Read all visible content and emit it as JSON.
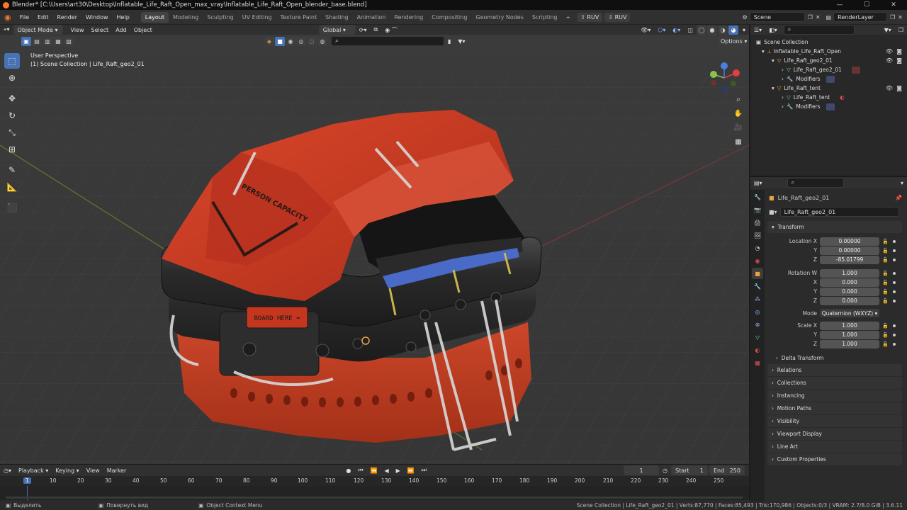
{
  "title_bar": {
    "text": "Blender* [C:\\Users\\art30\\Desktop\\Inflatable_Life_Raft_Open_max_vray\\Inflatable_Life_Raft_Open_blender_base.blend]",
    "min": "—",
    "max": "☐",
    "close": "✕"
  },
  "menu": [
    "File",
    "Edit",
    "Render",
    "Window",
    "Help"
  ],
  "workspaces": [
    "Layout",
    "Modeling",
    "Sculpting",
    "UV Editing",
    "Texture Paint",
    "Shading",
    "Animation",
    "Rendering",
    "Compositing",
    "Geometry Nodes",
    "Scripting"
  ],
  "addons": {
    "btn1": "RUV",
    "btn2": "RUV"
  },
  "scene": "Scene",
  "render_layer": "RenderLayer",
  "viewport": {
    "mode": "Object Mode",
    "menus": [
      "View",
      "Select",
      "Add",
      "Object"
    ],
    "transform_orientation": "Global",
    "perspective": "User Perspective",
    "collection_info": "(1) Scene Collection | Life_Raft_geo2_01",
    "options": "Options",
    "raft_label": "BOARD HERE ➡",
    "tent_label": "PERSON CAPACITY"
  },
  "outliner": {
    "root": "Scene Collection",
    "items": [
      {
        "label": "Inflatable_Life_Raft_Open",
        "indent": 1
      },
      {
        "label": "Life_Raft_geo2_01",
        "indent": 2
      },
      {
        "label": "Life_Raft_geo2_01",
        "indent": 3
      },
      {
        "label": "Modifiers",
        "indent": 3
      },
      {
        "label": "Life_Raft_tent",
        "indent": 2
      },
      {
        "label": "Life_Raft_tent",
        "indent": 3
      },
      {
        "label": "Modifiers",
        "indent": 3
      }
    ]
  },
  "properties": {
    "object_name": "Life_Raft_geo2_01",
    "object_field": "Life_Raft_geo2_01",
    "transform_header": "Transform",
    "location": {
      "label": "Location X",
      "x": "0.00000",
      "y": "0.00000",
      "z": "-85.01799"
    },
    "rotation": {
      "label": "Rotation W",
      "w": "1.000",
      "x": "0.000",
      "y": "0.000",
      "z": "0.000"
    },
    "mode": {
      "label": "Mode",
      "value": "Quaternion (WXYZ)"
    },
    "scale": {
      "label": "Scale X",
      "x": "1.000",
      "y": "1.000",
      "z": "1.000"
    },
    "axis_y": "Y",
    "axis_z": "Z",
    "axis_x": "X",
    "delta": "Delta Transform",
    "panels": [
      "Relations",
      "Collections",
      "Instancing",
      "Motion Paths",
      "Visibility",
      "Viewport Display",
      "Line Art",
      "Custom Properties"
    ]
  },
  "timeline": {
    "menus": [
      "Playback",
      "Keying",
      "View",
      "Marker"
    ],
    "current_frame": "1",
    "start_label": "Start",
    "start": "1",
    "end_label": "End",
    "end": "250",
    "ticks": [
      "1",
      "10",
      "20",
      "30",
      "40",
      "50",
      "60",
      "70",
      "80",
      "90",
      "100",
      "110",
      "120",
      "130",
      "140",
      "150",
      "160",
      "170",
      "180",
      "190",
      "200",
      "210",
      "220",
      "230",
      "240",
      "250"
    ]
  },
  "status": {
    "select": "Выделить",
    "rotate": "Повернуть вид",
    "context": "Object Context Menu",
    "stats": "Scene Collection | Life_Raft_geo2_01 | Verts:87,770 | Faces:85,493 | Tris:170,986 | Objects:0/3 | VRAM: 2.7/8.0 GiB | 3.6.11"
  }
}
